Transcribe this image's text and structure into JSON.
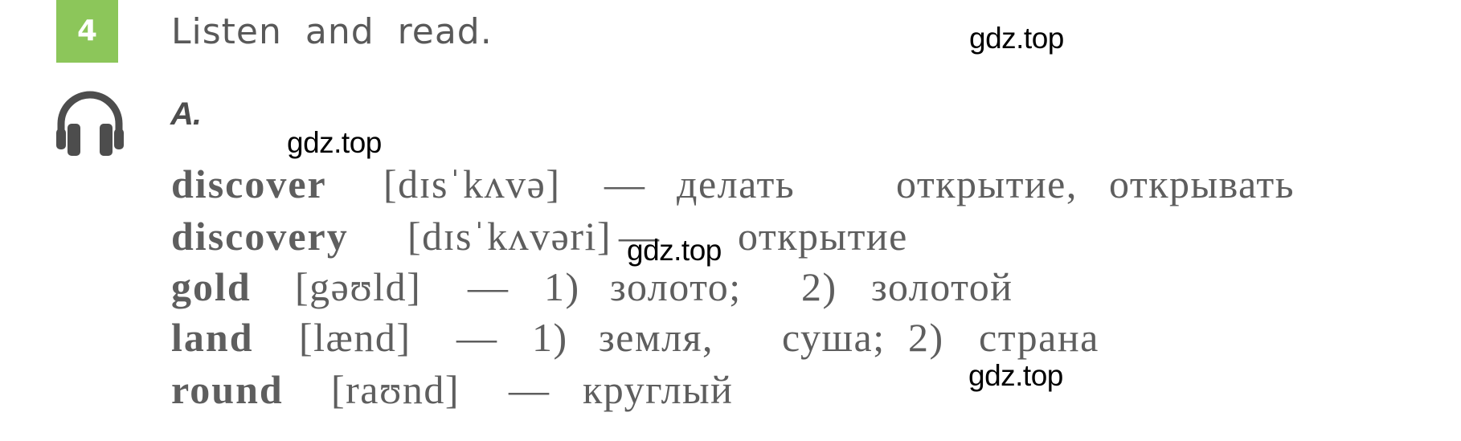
{
  "exercise": {
    "number": "4",
    "instruction": "Listen and read.",
    "badge_color": "#8cc65a",
    "audio_icon": "headphones-icon",
    "section_label": "A."
  },
  "vocabulary": [
    {
      "word": "discover",
      "transcription": "[dɪsˈkʌvə]",
      "dash": "—",
      "parts": [
        "делать",
        "открытие,",
        "открывать"
      ]
    },
    {
      "word": "discovery",
      "transcription": "[dɪsˈkʌvəri]",
      "dash": "—",
      "parts": [
        "открытие"
      ]
    },
    {
      "word": "gold",
      "transcription": "[gəʊld]",
      "dash": "—",
      "parts": [
        "1)",
        "золото;",
        "2)",
        "золотой"
      ]
    },
    {
      "word": "land",
      "transcription": "[lænd]",
      "dash": "—",
      "parts": [
        "1)",
        "земля,",
        "суша;",
        "2)",
        "страна"
      ]
    },
    {
      "word": "round",
      "transcription": "[raʊnd]",
      "dash": "—",
      "parts": [
        "круглый"
      ]
    }
  ],
  "watermarks": [
    "gdz.top",
    "gdz.top",
    "gdz.top",
    "gdz.top"
  ]
}
